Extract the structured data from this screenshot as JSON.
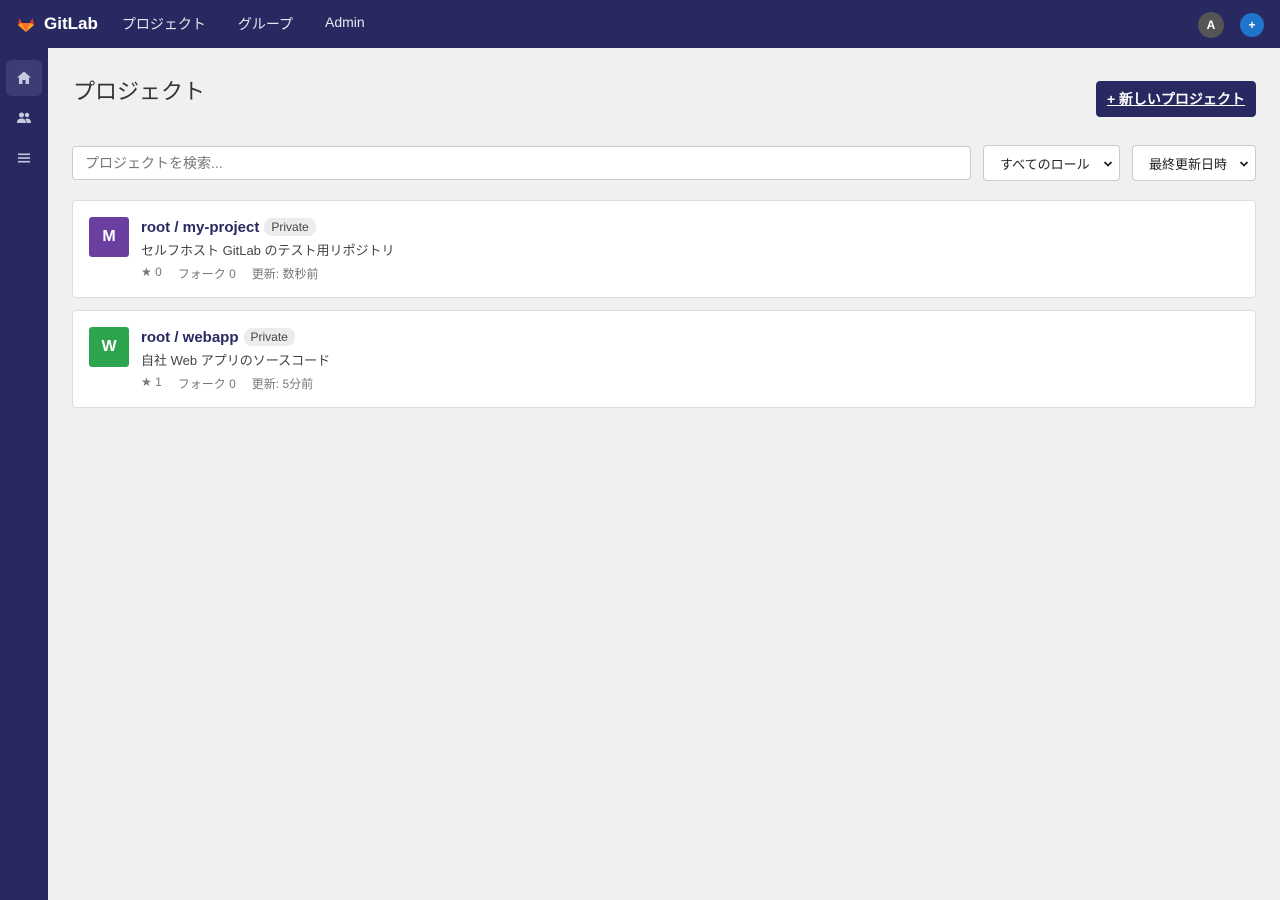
{
  "topbar": {
    "brand": "GitLab",
    "nav": [
      "プロジェクト",
      "グループ",
      "Admin"
    ],
    "avatar_initial": "A",
    "plus_label": "+"
  },
  "sidebar": {
    "items": [
      {
        "icon": "home-icon",
        "active": true
      },
      {
        "icon": "users-icon",
        "active": false
      },
      {
        "icon": "menu-icon",
        "active": false
      }
    ]
  },
  "main": {
    "title": "プロジェクト",
    "new_project_label": "+ 新しいプロジェクト",
    "search_placeholder": "プロジェクトを検索...",
    "role_filter": "すべてのロール",
    "sort_filter": "最終更新日時"
  },
  "projects": [
    {
      "initial": "M",
      "color": "#6b3fa0",
      "name": "root / my-project",
      "visibility": "Private",
      "description": "セルフホスト GitLab のテスト用リポジトリ",
      "stars": "★ 0",
      "forks": "フォーク 0",
      "updated": "更新: 数秒前"
    },
    {
      "initial": "W",
      "color": "#2da44e",
      "name": "root / webapp",
      "visibility": "Private",
      "description": "自社 Web アプリのソースコード",
      "stars": "★ 1",
      "forks": "フォーク 0",
      "updated": "更新: 5分前"
    }
  ],
  "colors": {
    "topbar": "#292961",
    "accent": "#1f75cb"
  }
}
